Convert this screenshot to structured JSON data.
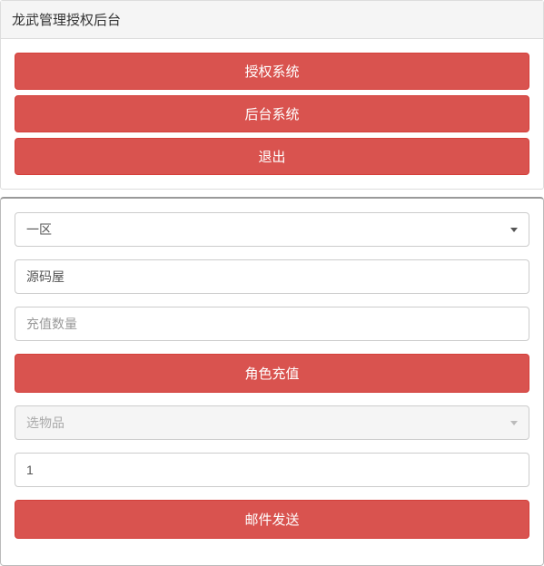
{
  "header": {
    "title": "龙武管理授权后台"
  },
  "nav": {
    "auth_system": "授权系统",
    "backend_system": "后台系统",
    "logout": "退出"
  },
  "form": {
    "zone_select": "一区",
    "char_name_value": "源码屋",
    "recharge_amount_placeholder": "充值数量",
    "char_recharge_btn": "角色充值",
    "item_select": "选物品",
    "qty_value": "1",
    "mail_send_btn": "邮件发送"
  }
}
